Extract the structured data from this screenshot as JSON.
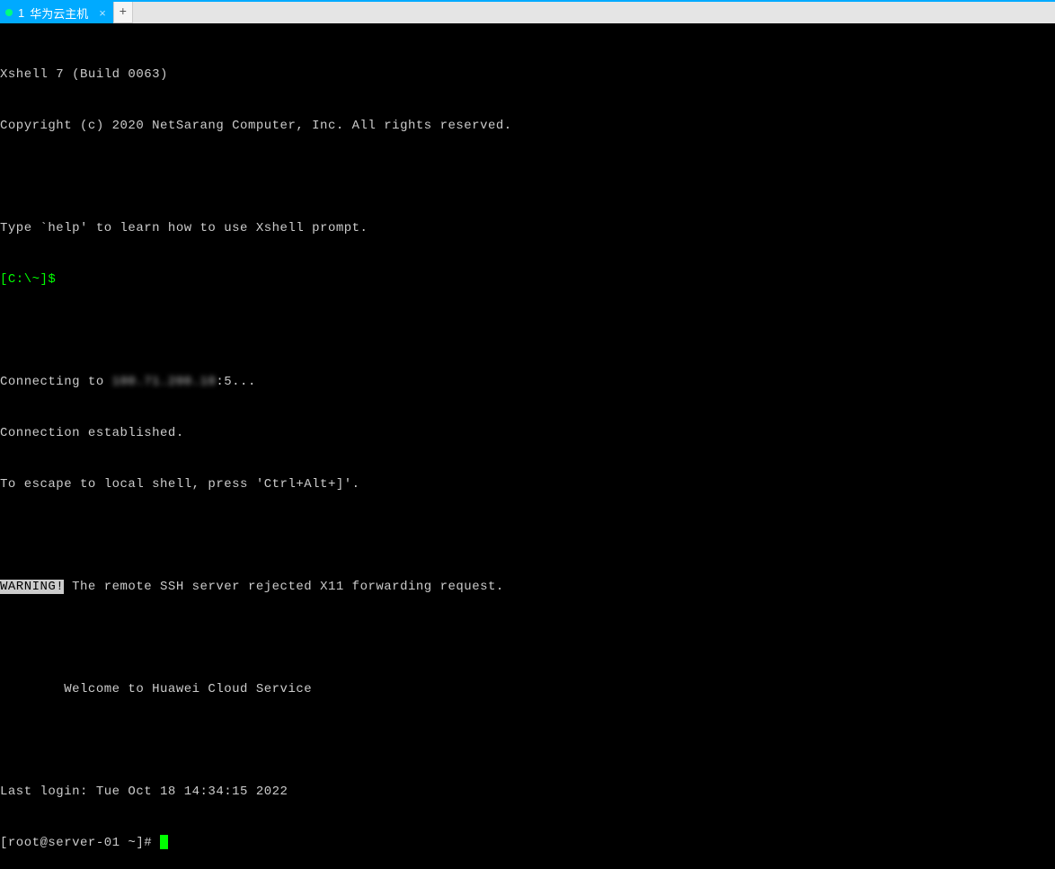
{
  "tabBar": {
    "activeTab": {
      "index": "1",
      "label": "华为云主机",
      "closeGlyph": "×"
    },
    "addTabGlyph": "+"
  },
  "terminal": {
    "app_line": "Xshell 7 (Build 0063)",
    "copyright": "Copyright (c) 2020 NetSarang Computer, Inc. All rights reserved.",
    "help_hint": "Type `help' to learn how to use Xshell prompt.",
    "local_prompt": "[C:\\~]$ ",
    "connecting_prefix": "Connecting to ",
    "connecting_host_obscured": "100.71.200.10",
    "connecting_suffix": ":5...",
    "established": "Connection established.",
    "escape_hint": "To escape to local shell, press 'Ctrl+Alt+]'.",
    "warning_label": "WARNING!",
    "warning_text": " The remote SSH server rejected X11 forwarding request.",
    "welcome": "        Welcome to Huawei Cloud Service",
    "last_login": "Last login: Tue Oct 18 14:34:15 2022",
    "root_prompt": "[root@server-01 ~]# "
  }
}
